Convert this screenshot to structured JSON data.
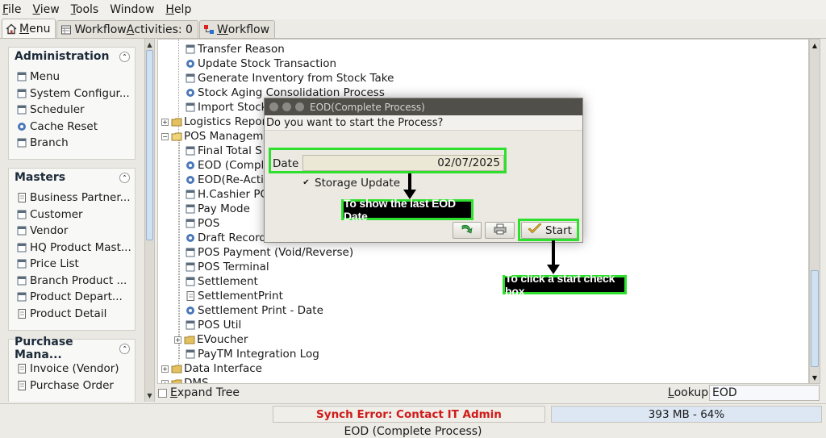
{
  "menubar": {
    "items": [
      {
        "pre": "",
        "key": "F",
        "post": "ile"
      },
      {
        "pre": "",
        "key": "V",
        "post": "iew"
      },
      {
        "pre": "",
        "key": "T",
        "post": "ools"
      },
      {
        "pre": "",
        "key": "",
        "post": "Window"
      },
      {
        "pre": "",
        "key": "H",
        "post": "elp"
      }
    ]
  },
  "tabs": [
    {
      "pre": "",
      "key": "M",
      "post": "enu"
    },
    {
      "pre": "Workflow ",
      "key": "A",
      "post": "ctivities: 0"
    },
    {
      "pre": "",
      "key": "W",
      "post": "orkflow"
    }
  ],
  "sidebar": {
    "administration": {
      "title": "Administration",
      "items": [
        "Menu",
        "System Configur...",
        "Scheduler",
        "Cache Reset",
        "Branch"
      ]
    },
    "masters": {
      "title": "Masters",
      "items": [
        "Business Partner...",
        "Customer",
        "Vendor",
        "HQ Product Mast...",
        "Price List",
        "Branch Product ...",
        "Product Depart...",
        "Product Detail"
      ]
    },
    "purchase": {
      "title": "Purchase Mana...",
      "items": [
        "Invoice (Vendor)",
        "Purchase Order"
      ]
    }
  },
  "tree": {
    "rows": [
      "Transfer Reason",
      "Update Stock Transaction",
      "Generate Inventory from Stock Take",
      "Stock Aging Consolidation Process",
      "Import Stock",
      "Logistics Report",
      "POS Management",
      "Final Total S",
      "EOD (Comple",
      "EOD(Re-Activ",
      "H.Cashier PO",
      "Pay Mode",
      "POS",
      "Draft Record",
      "POS Payment (Void/Reverse)",
      "POS Terminal",
      "Settlement",
      "SettlementPrint",
      "Settlement Print - Date",
      "POS Util",
      "EVoucher",
      "PayTM Integration Log",
      "Data Interface",
      "DMS"
    ]
  },
  "bottom": {
    "expand_tree": {
      "pre": "",
      "key": "E",
      "post": "xpand Tree"
    },
    "lookup_label": {
      "pre": "",
      "key": "L",
      "post": "ookup"
    },
    "lookup_value": "EOD"
  },
  "status": {
    "sync_error": "Synch Error: Contact IT Admin",
    "memory": "393 MB - 64%",
    "footer": "EOD (Complete Process)"
  },
  "dialog": {
    "title": "EOD(Complete Process)",
    "question": "Do you want to start the Process?",
    "date_label": "Date",
    "date_value": "02/07/2025",
    "storage_label": "Storage Update",
    "storage_checked": true,
    "start_label": "Start"
  },
  "annotations": {
    "date_callout": "To show the last EOD Date",
    "start_callout": "To click a start check box"
  },
  "colors": {
    "highlight": "#2ee02e",
    "sync_error_text": "#d01a1a",
    "memory_bg": "#dce7f3"
  }
}
